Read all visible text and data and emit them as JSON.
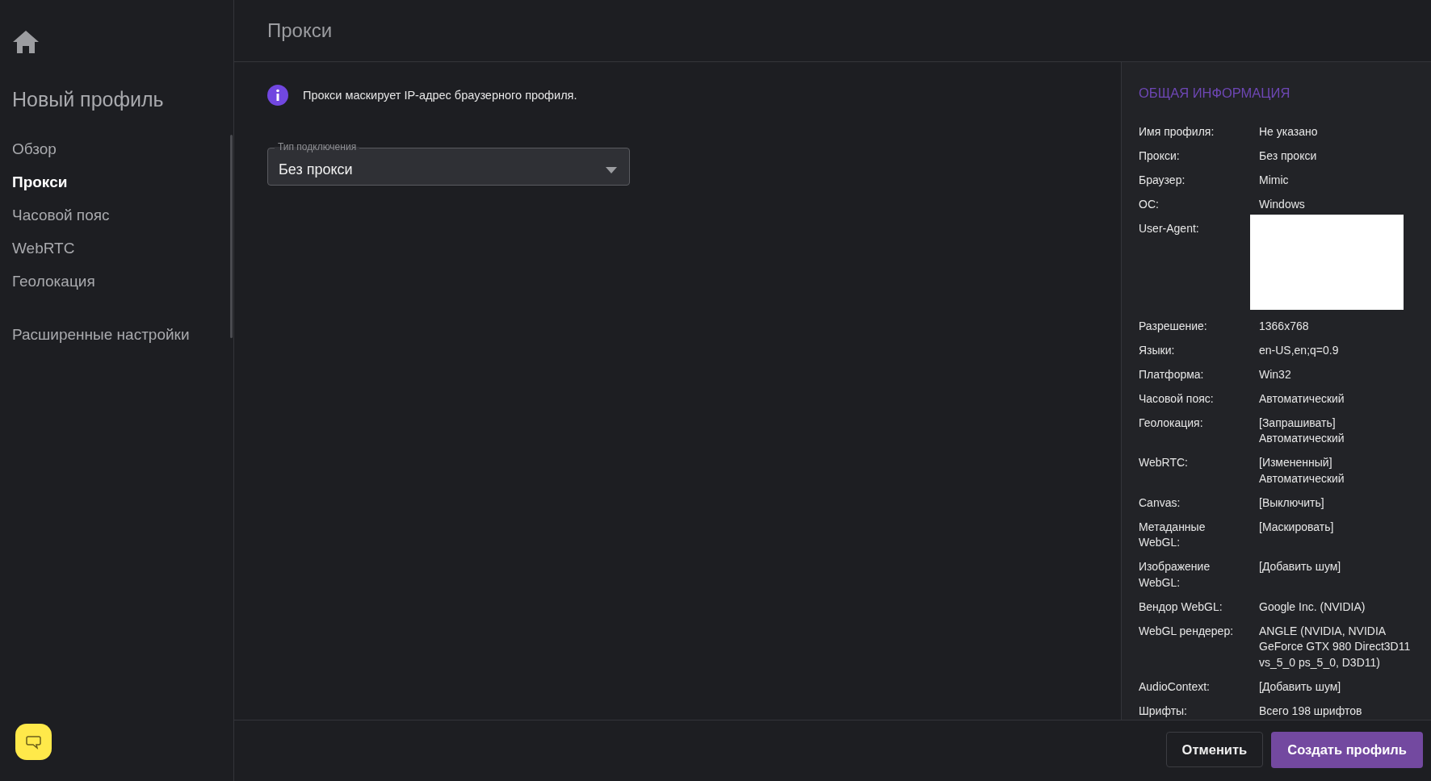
{
  "sidebar": {
    "title": "Новый профиль",
    "items": [
      {
        "label": "Обзор",
        "selected": false
      },
      {
        "label": "Прокси",
        "selected": true
      },
      {
        "label": "Часовой пояс",
        "selected": false
      },
      {
        "label": "WebRTC",
        "selected": false
      },
      {
        "label": "Геолокация",
        "selected": false
      }
    ],
    "advanced_link": "Расширенные настройки"
  },
  "header": {
    "title": "Прокси"
  },
  "info": {
    "text": "Прокси маскирует IP-адрес браузерного профиля."
  },
  "connection_select": {
    "label": "Тип подключения",
    "value": "Без прокси"
  },
  "summary": {
    "title": "ОБЩАЯ ИНФОРМАЦИЯ",
    "rows": [
      {
        "kind": "text",
        "label": "Имя профиля:",
        "value": [
          "Не указано"
        ]
      },
      {
        "kind": "text",
        "label": "Прокси:",
        "value": [
          "Без прокси"
        ]
      },
      {
        "kind": "text",
        "label": "Браузер:",
        "value": [
          "Mimic"
        ]
      },
      {
        "kind": "text",
        "label": "ОС:",
        "value": [
          "Windows"
        ]
      },
      {
        "kind": "redacted",
        "label": "User-Agent:"
      },
      {
        "kind": "text",
        "label": "Разрешение:",
        "value": [
          "1366x768"
        ]
      },
      {
        "kind": "text",
        "label": "Языки:",
        "value": [
          "en-US,en;q=0.9"
        ]
      },
      {
        "kind": "text",
        "label": "Платформа:",
        "value": [
          "Win32"
        ]
      },
      {
        "kind": "text",
        "label": "Часовой пояс:",
        "value": [
          "Автоматический"
        ]
      },
      {
        "kind": "text",
        "label": "Геолокация:",
        "value": [
          "[Запрашивать]",
          "Автоматический"
        ]
      },
      {
        "kind": "text",
        "label": "WebRTC:",
        "value": [
          "[Измененный]",
          "Автоматический"
        ]
      },
      {
        "kind": "text",
        "label": "Canvas:",
        "value": [
          "[Выключить]"
        ]
      },
      {
        "kind": "text",
        "label": "Метаданные WebGL:",
        "value": [
          "[Маскировать]"
        ]
      },
      {
        "kind": "text",
        "label": "Изображение WebGL:",
        "value": [
          "[Добавить шум]"
        ]
      },
      {
        "kind": "text",
        "label": "Вендор WebGL:",
        "value": [
          "Google Inc. (NVIDIA)"
        ]
      },
      {
        "kind": "text",
        "label": "WebGL рендерер:",
        "value": [
          "ANGLE (NVIDIA, NVIDIA",
          "GeForce GTX 980 Direct3D11",
          "vs_5_0 ps_5_0, D3D11)"
        ]
      },
      {
        "kind": "text",
        "label": "AudioContext:",
        "value": [
          "[Добавить шум]"
        ]
      },
      {
        "kind": "text",
        "label": "Шрифты:",
        "value": [
          "Всего 198 шрифтов"
        ]
      }
    ]
  },
  "footer": {
    "cancel": "Отменить",
    "create": "Создать профиль"
  }
}
